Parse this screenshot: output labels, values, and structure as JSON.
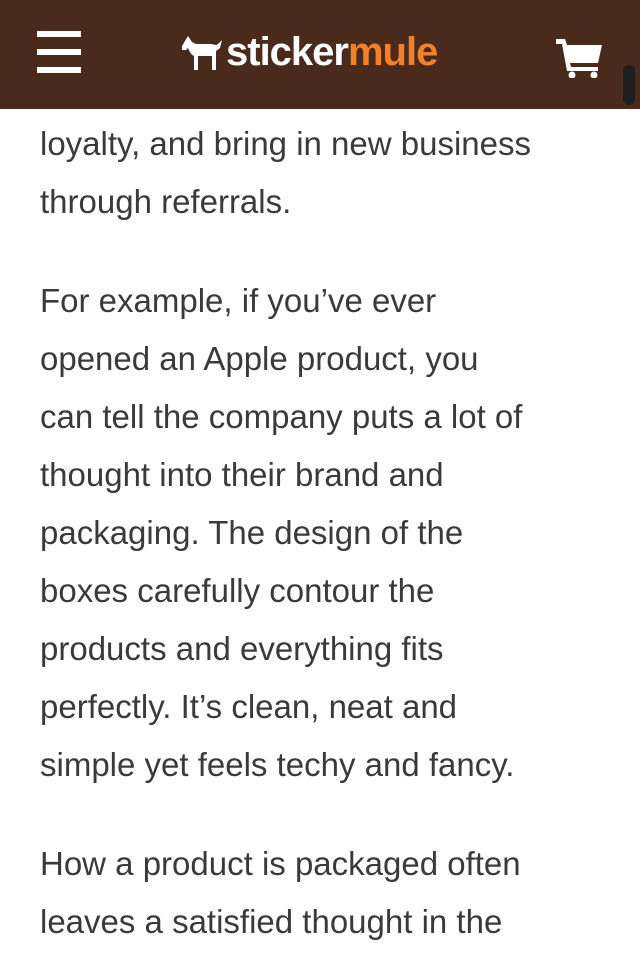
{
  "header": {
    "logo_primary": "sticker",
    "logo_secondary": "mule",
    "menu_icon": "hamburger-menu-icon",
    "cart_icon": "shopping-cart-icon",
    "logo_icon": "mule-icon",
    "colors": {
      "header_bg": "#4a2a1c",
      "logo_accent": "#f4802a",
      "text": "#3a3a3a"
    }
  },
  "article": {
    "paragraphs": [
      {
        "lines": [
          "loyalty, and bring in new business",
          "through referrals."
        ]
      },
      {
        "lines": [
          "For example, if you’ve ever",
          "opened an Apple product, you",
          "can tell the company puts a lot of",
          "thought into their brand and",
          "packaging. The design of the",
          "boxes carefully contour the",
          "products and everything fits",
          "perfectly. It’s clean, neat and",
          "simple yet feels techy and fancy."
        ]
      },
      {
        "lines": [
          "How a product is packaged often",
          "leaves a satisfied thought in the"
        ]
      }
    ]
  }
}
